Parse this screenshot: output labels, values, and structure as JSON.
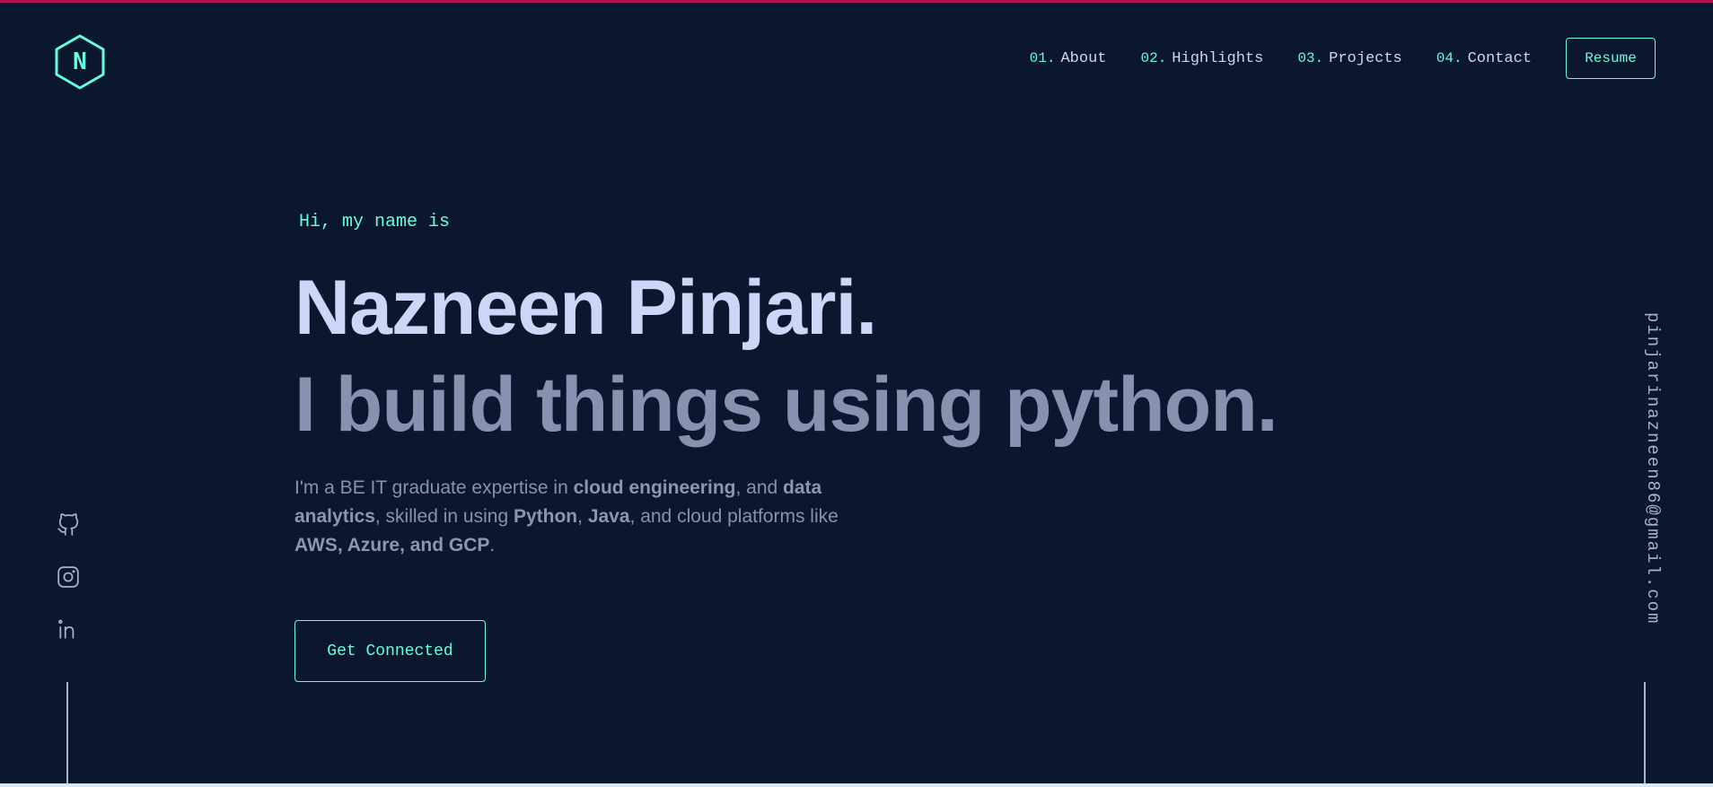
{
  "logo": {
    "letter": "N",
    "icon": "hexagon-logo-icon"
  },
  "nav": {
    "items": [
      {
        "num": "01.",
        "label": "About"
      },
      {
        "num": "02.",
        "label": "Highlights"
      },
      {
        "num": "03.",
        "label": "Projects"
      },
      {
        "num": "04.",
        "label": "Contact"
      }
    ],
    "resume_label": "Resume"
  },
  "hero": {
    "intro": "Hi, my name is",
    "name": "Nazneen Pinjari.",
    "tagline": "I build things using python.",
    "description": {
      "t1": "I'm a BE IT graduate expertise in ",
      "b1": "cloud engineering",
      "t2": ", and ",
      "b2": "data analytics",
      "t3": ", skilled in using ",
      "b3": "Python",
      "t4": ", ",
      "b4": "Java",
      "t5": ", and cloud platforms like ",
      "b5": "AWS, Azure, and GCP",
      "t6": "."
    },
    "cta_label": "Get Connected"
  },
  "social": {
    "icons": [
      "github-icon",
      "instagram-icon",
      "linkedin-icon"
    ]
  },
  "email": "pinjarinazneen86@gmail.com",
  "colors": {
    "background": "#0b172e",
    "accent": "#64ffda",
    "heading": "#ccd6f6",
    "muted": "#8892b0",
    "top_bar": "#b3124f"
  }
}
